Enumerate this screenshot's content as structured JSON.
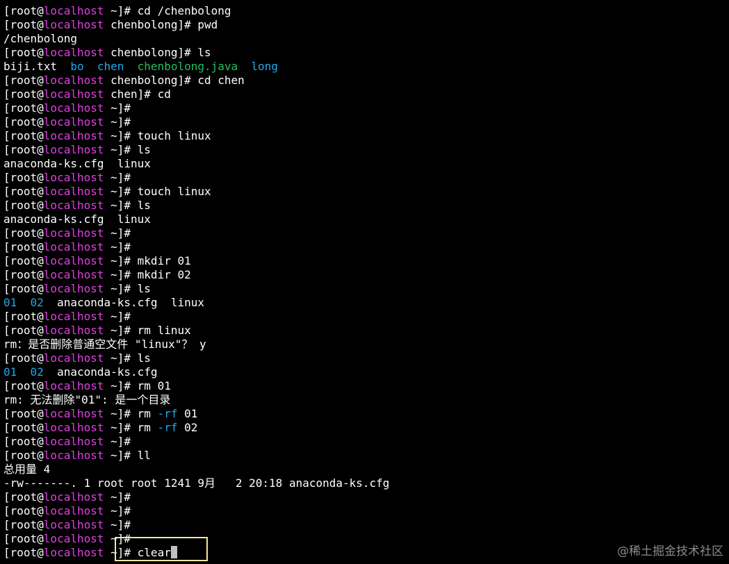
{
  "colors": {
    "text": "#ffffff",
    "host": "#e040e0",
    "dir": "#20a8e8",
    "exec": "#20c060",
    "flag": "#20a8e8",
    "background": "#000000",
    "highlight": "#f4e6a3"
  },
  "terminal": {
    "lines": [
      [
        {
          "t": "[root@",
          "c": "text"
        },
        {
          "t": "localhost",
          "c": "host"
        },
        {
          "t": " ~]# cd /chenbolong",
          "c": "text"
        }
      ],
      [
        {
          "t": "[root@",
          "c": "text"
        },
        {
          "t": "localhost",
          "c": "host"
        },
        {
          "t": " chenbolong]# pwd",
          "c": "text"
        }
      ],
      [
        {
          "t": "/chenbolong",
          "c": "text"
        }
      ],
      [
        {
          "t": "[root@",
          "c": "text"
        },
        {
          "t": "localhost",
          "c": "host"
        },
        {
          "t": " chenbolong]# ls",
          "c": "text"
        }
      ],
      [
        {
          "t": "biji.txt  ",
          "c": "text"
        },
        {
          "t": "bo",
          "c": "dir"
        },
        {
          "t": "  ",
          "c": "text"
        },
        {
          "t": "chen",
          "c": "dir"
        },
        {
          "t": "  ",
          "c": "text"
        },
        {
          "t": "chenbolong.java",
          "c": "exec"
        },
        {
          "t": "  ",
          "c": "text"
        },
        {
          "t": "long",
          "c": "dir"
        }
      ],
      [
        {
          "t": "[root@",
          "c": "text"
        },
        {
          "t": "localhost",
          "c": "host"
        },
        {
          "t": " chenbolong]# cd chen",
          "c": "text"
        }
      ],
      [
        {
          "t": "[root@",
          "c": "text"
        },
        {
          "t": "localhost",
          "c": "host"
        },
        {
          "t": " chen]# cd",
          "c": "text"
        }
      ],
      [
        {
          "t": "[root@",
          "c": "text"
        },
        {
          "t": "localhost",
          "c": "host"
        },
        {
          "t": " ~]#",
          "c": "text"
        }
      ],
      [
        {
          "t": "[root@",
          "c": "text"
        },
        {
          "t": "localhost",
          "c": "host"
        },
        {
          "t": " ~]#",
          "c": "text"
        }
      ],
      [
        {
          "t": "[root@",
          "c": "text"
        },
        {
          "t": "localhost",
          "c": "host"
        },
        {
          "t": " ~]# touch linux",
          "c": "text"
        }
      ],
      [
        {
          "t": "[root@",
          "c": "text"
        },
        {
          "t": "localhost",
          "c": "host"
        },
        {
          "t": " ~]# ls",
          "c": "text"
        }
      ],
      [
        {
          "t": "anaconda-ks.cfg  linux",
          "c": "text"
        }
      ],
      [
        {
          "t": "[root@",
          "c": "text"
        },
        {
          "t": "localhost",
          "c": "host"
        },
        {
          "t": " ~]#",
          "c": "text"
        }
      ],
      [
        {
          "t": "[root@",
          "c": "text"
        },
        {
          "t": "localhost",
          "c": "host"
        },
        {
          "t": " ~]# touch linux",
          "c": "text"
        }
      ],
      [
        {
          "t": "[root@",
          "c": "text"
        },
        {
          "t": "localhost",
          "c": "host"
        },
        {
          "t": " ~]# ls",
          "c": "text"
        }
      ],
      [
        {
          "t": "anaconda-ks.cfg  linux",
          "c": "text"
        }
      ],
      [
        {
          "t": "[root@",
          "c": "text"
        },
        {
          "t": "localhost",
          "c": "host"
        },
        {
          "t": " ~]#",
          "c": "text"
        }
      ],
      [
        {
          "t": "[root@",
          "c": "text"
        },
        {
          "t": "localhost",
          "c": "host"
        },
        {
          "t": " ~]#",
          "c": "text"
        }
      ],
      [
        {
          "t": "[root@",
          "c": "text"
        },
        {
          "t": "localhost",
          "c": "host"
        },
        {
          "t": " ~]# mkdir 01",
          "c": "text"
        }
      ],
      [
        {
          "t": "[root@",
          "c": "text"
        },
        {
          "t": "localhost",
          "c": "host"
        },
        {
          "t": " ~]# mkdir 02",
          "c": "text"
        }
      ],
      [
        {
          "t": "[root@",
          "c": "text"
        },
        {
          "t": "localhost",
          "c": "host"
        },
        {
          "t": " ~]# ls",
          "c": "text"
        }
      ],
      [
        {
          "t": "01",
          "c": "dir"
        },
        {
          "t": "  ",
          "c": "text"
        },
        {
          "t": "02",
          "c": "dir"
        },
        {
          "t": "  anaconda-ks.cfg  linux",
          "c": "text"
        }
      ],
      [
        {
          "t": "[root@",
          "c": "text"
        },
        {
          "t": "localhost",
          "c": "host"
        },
        {
          "t": " ~]#",
          "c": "text"
        }
      ],
      [
        {
          "t": "[root@",
          "c": "text"
        },
        {
          "t": "localhost",
          "c": "host"
        },
        {
          "t": " ~]# rm linux",
          "c": "text"
        }
      ],
      [
        {
          "t": "rm：是否删除普通空文件 \"linux\"？ y",
          "c": "text"
        }
      ],
      [
        {
          "t": "[root@",
          "c": "text"
        },
        {
          "t": "localhost",
          "c": "host"
        },
        {
          "t": " ~]# ls",
          "c": "text"
        }
      ],
      [
        {
          "t": "01",
          "c": "dir"
        },
        {
          "t": "  ",
          "c": "text"
        },
        {
          "t": "02",
          "c": "dir"
        },
        {
          "t": "  anaconda-ks.cfg",
          "c": "text"
        }
      ],
      [
        {
          "t": "[root@",
          "c": "text"
        },
        {
          "t": "localhost",
          "c": "host"
        },
        {
          "t": " ~]# rm 01",
          "c": "text"
        }
      ],
      [
        {
          "t": "rm: 无法删除\"01\": 是一个目录",
          "c": "text"
        }
      ],
      [
        {
          "t": "[root@",
          "c": "text"
        },
        {
          "t": "localhost",
          "c": "host"
        },
        {
          "t": " ~]# rm ",
          "c": "text"
        },
        {
          "t": "-rf",
          "c": "flag"
        },
        {
          "t": " 01",
          "c": "text"
        }
      ],
      [
        {
          "t": "[root@",
          "c": "text"
        },
        {
          "t": "localhost",
          "c": "host"
        },
        {
          "t": " ~]# rm ",
          "c": "text"
        },
        {
          "t": "-rf",
          "c": "flag"
        },
        {
          "t": " 02",
          "c": "text"
        }
      ],
      [
        {
          "t": "[root@",
          "c": "text"
        },
        {
          "t": "localhost",
          "c": "host"
        },
        {
          "t": " ~]#",
          "c": "text"
        }
      ],
      [
        {
          "t": "[root@",
          "c": "text"
        },
        {
          "t": "localhost",
          "c": "host"
        },
        {
          "t": " ~]# ll",
          "c": "text"
        }
      ],
      [
        {
          "t": "总用量 4",
          "c": "text"
        }
      ],
      [
        {
          "t": "-rw-------. 1 root root 1241 9月   2 20:18 anaconda-ks.cfg",
          "c": "text"
        }
      ],
      [
        {
          "t": "[root@",
          "c": "text"
        },
        {
          "t": "localhost",
          "c": "host"
        },
        {
          "t": " ~]#",
          "c": "text"
        }
      ],
      [
        {
          "t": "[root@",
          "c": "text"
        },
        {
          "t": "localhost",
          "c": "host"
        },
        {
          "t": " ~]#",
          "c": "text"
        }
      ],
      [
        {
          "t": "[root@",
          "c": "text"
        },
        {
          "t": "localhost",
          "c": "host"
        },
        {
          "t": " ~]#",
          "c": "text"
        }
      ],
      [
        {
          "t": "[root@",
          "c": "text"
        },
        {
          "t": "localhost",
          "c": "host"
        },
        {
          "t": " ~]#",
          "c": "text"
        }
      ],
      [
        {
          "t": "[root@",
          "c": "text"
        },
        {
          "t": "localhost",
          "c": "host"
        },
        {
          "t": " ~]# clear",
          "c": "text"
        }
      ]
    ],
    "cursor_visible": true
  },
  "watermark": "@稀土掘金技术社区"
}
